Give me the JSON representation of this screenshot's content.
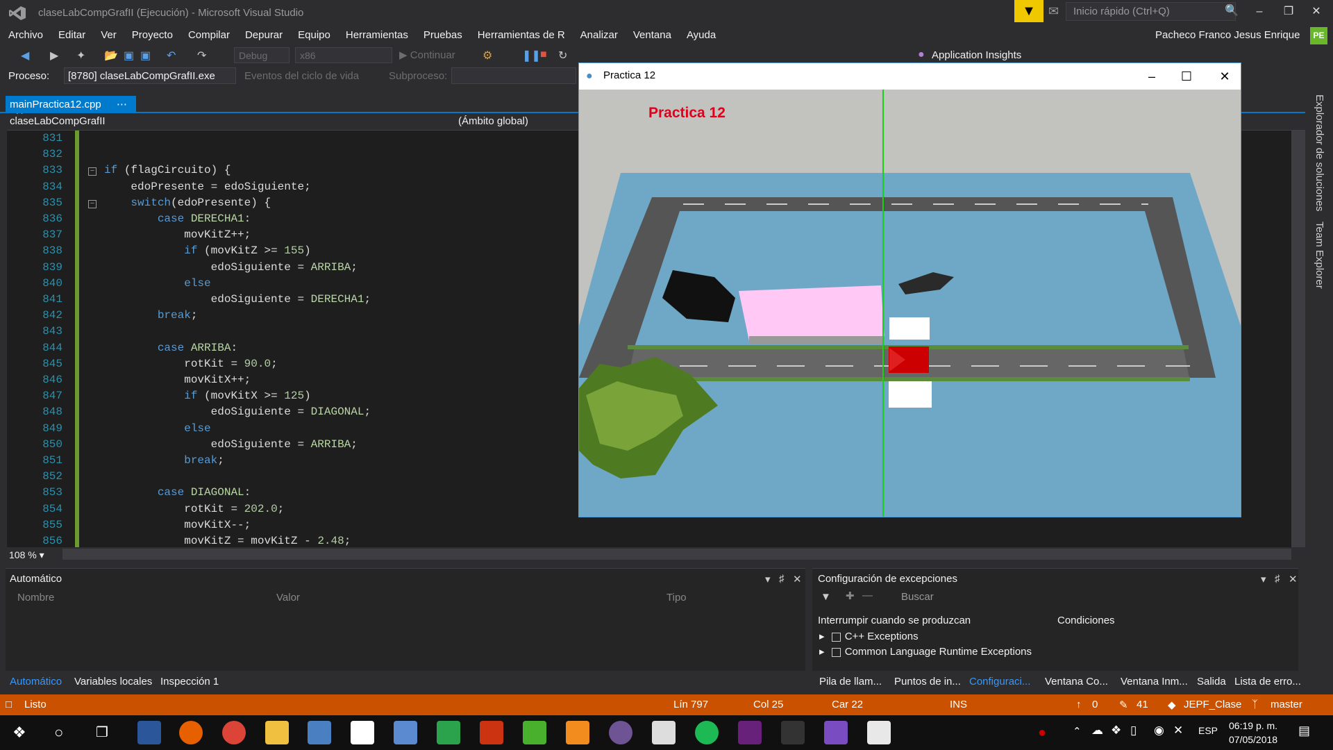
{
  "window_title": "claseLabCompGrafII (Ejecución) - Microsoft Visual Studio",
  "quick_launch": "Inicio rápido (Ctrl+Q)",
  "user": "Pacheco Franco Jesus Enrique",
  "user_initials": "PE",
  "menu": [
    "Archivo",
    "Editar",
    "Ver",
    "Proyecto",
    "Compilar",
    "Depurar",
    "Equipo",
    "Herramientas",
    "Pruebas",
    "Herramientas de R",
    "Analizar",
    "Ventana",
    "Ayuda"
  ],
  "toolbar": {
    "config": "Debug",
    "platform": "x86",
    "continue": "Continuar",
    "insights": "Application Insights"
  },
  "process": {
    "label": "Proceso:",
    "value": "[8780] claseLabCompGrafII.exe",
    "lifecycle": "Eventos del ciclo de vida",
    "subprocess": "Subproceso:"
  },
  "doc_tab": "mainPractica12.cpp",
  "nav": {
    "project": "claseLabCompGrafII",
    "scope": "(Ámbito global)"
  },
  "code_lines": [
    {
      "n": "831",
      "t": ""
    },
    {
      "n": "832",
      "t": ""
    },
    {
      "n": "833",
      "t": "if (flagCircuito) {"
    },
    {
      "n": "834",
      "t": "    edoPresente = edoSiguiente;"
    },
    {
      "n": "835",
      "t": "    switch(edoPresente) {"
    },
    {
      "n": "836",
      "t": "        case DERECHA1:"
    },
    {
      "n": "837",
      "t": "            movKitZ++;"
    },
    {
      "n": "838",
      "t": "            if (movKitZ >= 155)"
    },
    {
      "n": "839",
      "t": "                edoSiguiente = ARRIBA;"
    },
    {
      "n": "840",
      "t": "            else"
    },
    {
      "n": "841",
      "t": "                edoSiguiente = DERECHA1;"
    },
    {
      "n": "842",
      "t": "        break;"
    },
    {
      "n": "843",
      "t": ""
    },
    {
      "n": "844",
      "t": "        case ARRIBA:"
    },
    {
      "n": "845",
      "t": "            rotKit = 90.0;"
    },
    {
      "n": "846",
      "t": "            movKitX++;"
    },
    {
      "n": "847",
      "t": "            if (movKitX >= 125)"
    },
    {
      "n": "848",
      "t": "                edoSiguiente = DIAGONAL;"
    },
    {
      "n": "849",
      "t": "            else"
    },
    {
      "n": "850",
      "t": "                edoSiguiente = ARRIBA;"
    },
    {
      "n": "851",
      "t": "            break;"
    },
    {
      "n": "852",
      "t": ""
    },
    {
      "n": "853",
      "t": "        case DIAGONAL:"
    },
    {
      "n": "854",
      "t": "            rotKit = 202.0;"
    },
    {
      "n": "855",
      "t": "            movKitX--;"
    },
    {
      "n": "856",
      "t": "            movKitZ = movKitZ - 2.48;"
    }
  ],
  "zoom": "108 %",
  "gl_window": {
    "title": "Practica 12",
    "overlay": "Practica 12"
  },
  "right_rail": [
    "Explorador de soluciones",
    "Team Explorer"
  ],
  "auto_panel": {
    "title": "Automático",
    "cols": [
      "Nombre",
      "Valor",
      "Tipo"
    ],
    "tabs": [
      "Automático",
      "Variables locales",
      "Inspección 1"
    ]
  },
  "exc_panel": {
    "title": "Configuración de excepciones",
    "search": "Buscar",
    "col1": "Interrumpir cuando se produzcan",
    "col2": "Condiciones",
    "items": [
      "C++ Exceptions",
      "Common Language Runtime Exceptions"
    ],
    "tabs": [
      "Pila de llam...",
      "Puntos de in...",
      "Configuraci...",
      "Ventana Co...",
      "Ventana Inm...",
      "Salida",
      "Lista de erro..."
    ]
  },
  "status": {
    "ready": "Listo",
    "line": "Lín 797",
    "col": "Col 25",
    "car": "Car 22",
    "ins": "INS",
    "up": "0",
    "edits": "41",
    "repo": "JEPF_Clase",
    "branch": "master"
  },
  "clock": {
    "time": "06:19 p. m.",
    "date": "07/05/2018",
    "lang": "ESP"
  },
  "colors": {
    "accent": "#007acc",
    "status": "#ca5100",
    "sky": "#c4c4c4",
    "ground": "#6fa8c6",
    "truck": "#ffc8f5",
    "overlay_text": "#e0001b"
  }
}
